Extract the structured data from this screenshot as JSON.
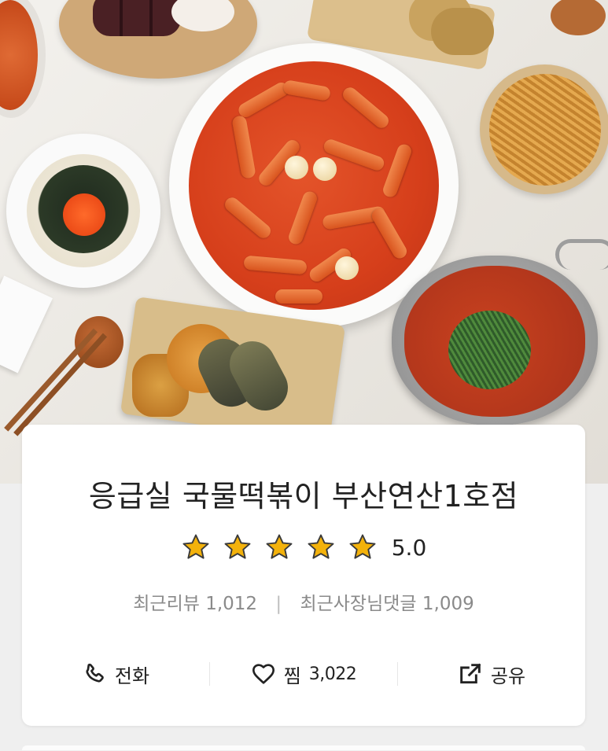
{
  "store": {
    "name": "응급실 국물떡볶이 부산연산1호점",
    "rating": "5.0",
    "stars": 5,
    "max_stars": 5
  },
  "stats": {
    "reviews_label": "최근리뷰 1,012",
    "owner_replies_label": "최근사장님댓글 1,009"
  },
  "actions": {
    "call_label": "전화",
    "favorite_label": "찜",
    "favorite_count": "3,022",
    "share_label": "공유"
  },
  "colors": {
    "star": "#f3b20b",
    "text": "#222222",
    "muted": "#8a8a8a"
  },
  "icons": {
    "call": "phone-icon",
    "favorite": "heart-icon",
    "share": "share-icon",
    "star": "star-icon"
  }
}
